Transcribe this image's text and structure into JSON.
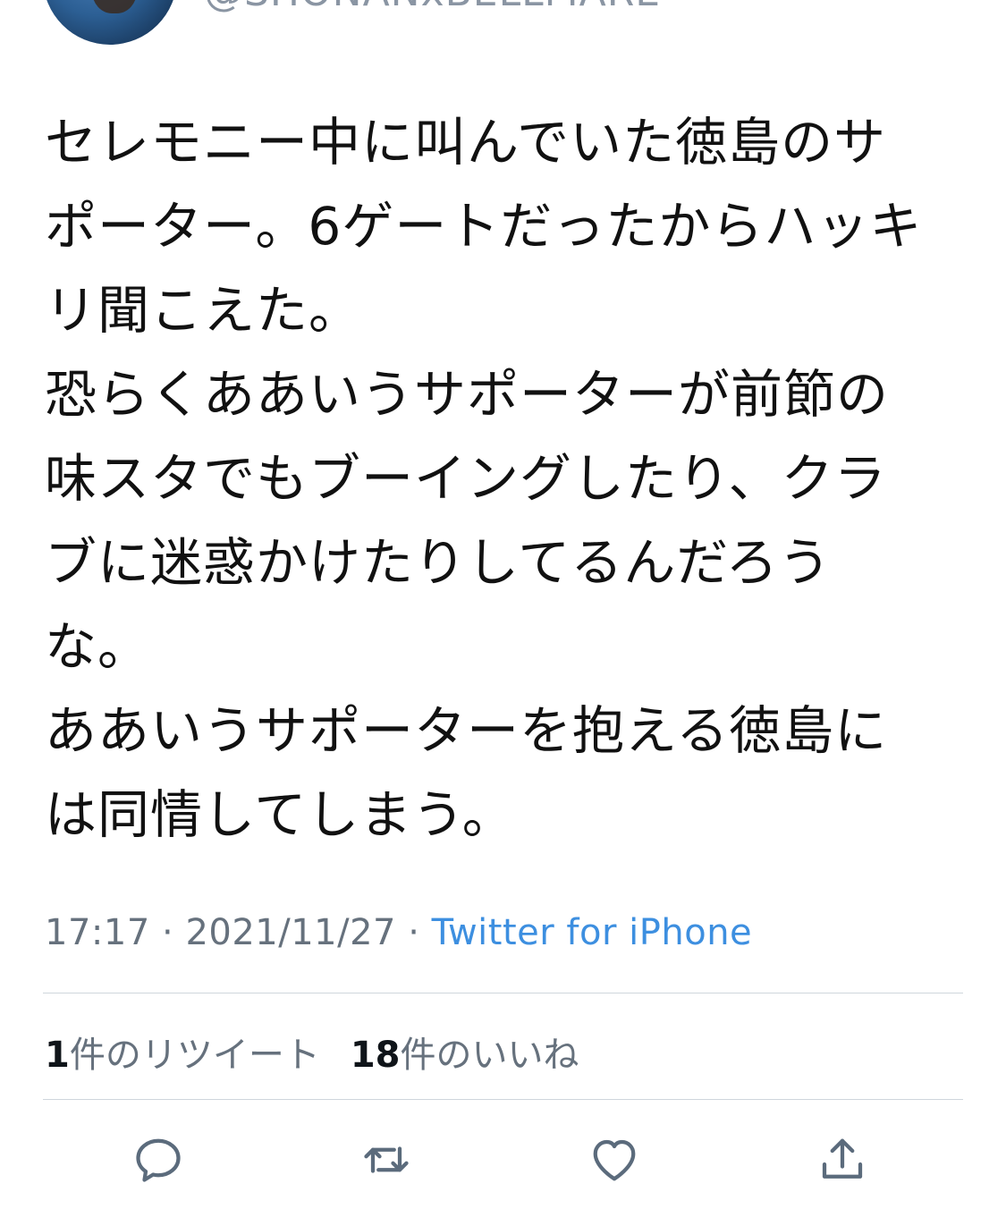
{
  "header": {
    "handle": "@SHONANxBELLMARE"
  },
  "tweet": {
    "lines": [
      "セレモニー中に叫んでいた徳島のサ",
      "ポーター。6ゲートだったからハッキ",
      "リ聞こえた。",
      "恐らくああいうサポーターが前節の",
      "味スタでもブーイングしたり、クラ",
      "ブに迷惑かけたりしてるんだろう",
      "な。",
      "ああいうサポーターを抱える徳島に",
      "は同情してしまう。"
    ],
    "time": "17:17",
    "separator1": " · ",
    "date": "2021/11/27",
    "separator2": " · ",
    "source": "Twitter for iPhone"
  },
  "stats": {
    "retweet_count": "1",
    "retweet_label": "件のリツイート",
    "like_count": "18",
    "like_label": "件のいいね"
  },
  "actions": {
    "reply_icon": "reply-icon",
    "retweet_icon": "retweet-icon",
    "like_icon": "heart-icon",
    "share_icon": "share-icon"
  },
  "colors": {
    "text": "#111111",
    "muted": "#66717d",
    "link": "#3d8fe0",
    "divider": "#cfd6dc",
    "icon": "#5b6b7c"
  }
}
